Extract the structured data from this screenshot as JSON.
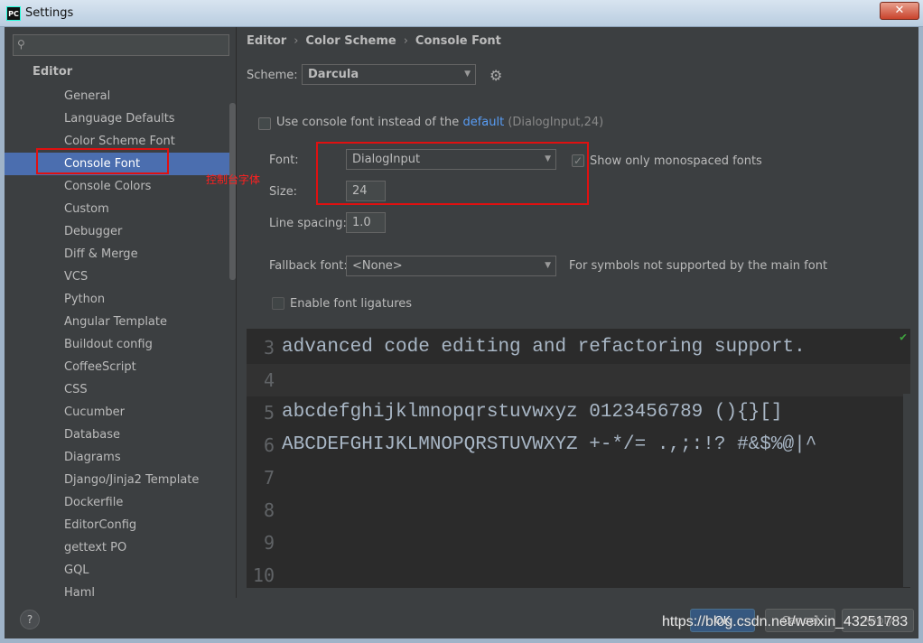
{
  "window": {
    "title": "Settings",
    "app_badge": "PC",
    "close_glyph": "✕"
  },
  "sidebar": {
    "search_placeholder": "",
    "section": "Editor",
    "items": [
      "General",
      "Language Defaults",
      "Color Scheme Font",
      "Console Font",
      "Console Colors",
      "Custom",
      "Debugger",
      "Diff & Merge",
      "VCS",
      "Python",
      "Angular Template",
      "Buildout config",
      "CoffeeScript",
      "CSS",
      "Cucumber",
      "Database",
      "Diagrams",
      "Django/Jinja2 Template",
      "Dockerfile",
      "EditorConfig",
      "gettext PO",
      "GQL",
      "Haml"
    ],
    "selected_index": 3
  },
  "annotation": "控制台字体",
  "breadcrumb": {
    "items": [
      "Editor",
      "Color Scheme",
      "Console Font"
    ]
  },
  "scheme": {
    "label": "Scheme:",
    "value": "Darcula"
  },
  "use_console_font": {
    "prefix": "Use console font instead of the",
    "link": "default",
    "suffix": "(DialogInput,24)",
    "checked": false
  },
  "font": {
    "label": "Font:",
    "value": "DialogInput"
  },
  "monospaced": {
    "label": "Show only monospaced fonts",
    "checked": true
  },
  "size": {
    "label": "Size:",
    "value": "24"
  },
  "line_spacing": {
    "label": "Line spacing:",
    "value": "1.0"
  },
  "fallback": {
    "label": "Fallback font:",
    "value": "<None>",
    "hint": "For symbols not supported by the main font"
  },
  "ligatures": {
    "label": "Enable font ligatures",
    "checked": false
  },
  "preview": {
    "lines": [
      {
        "num": "3",
        "text": "advanced code editing and refactoring support."
      },
      {
        "num": "4",
        "text": ""
      },
      {
        "num": "5",
        "text": "abcdefghijklmnopqrstuvwxyz 0123456789 (){}[]"
      },
      {
        "num": "6",
        "text": "ABCDEFGHIJKLMNOPQRSTUVWXYZ +-*/= .,;:!? #&$%@|^"
      },
      {
        "num": "7",
        "text": ""
      },
      {
        "num": "8",
        "text": ""
      },
      {
        "num": "9",
        "text": ""
      },
      {
        "num": "10",
        "text": ""
      }
    ],
    "current_line_index": 1
  },
  "footer": {
    "help": "?",
    "ok": "OK",
    "cancel": "Cancel",
    "apply": "Apply"
  },
  "watermark": "https://blog.csdn.net/weixin_43251783"
}
